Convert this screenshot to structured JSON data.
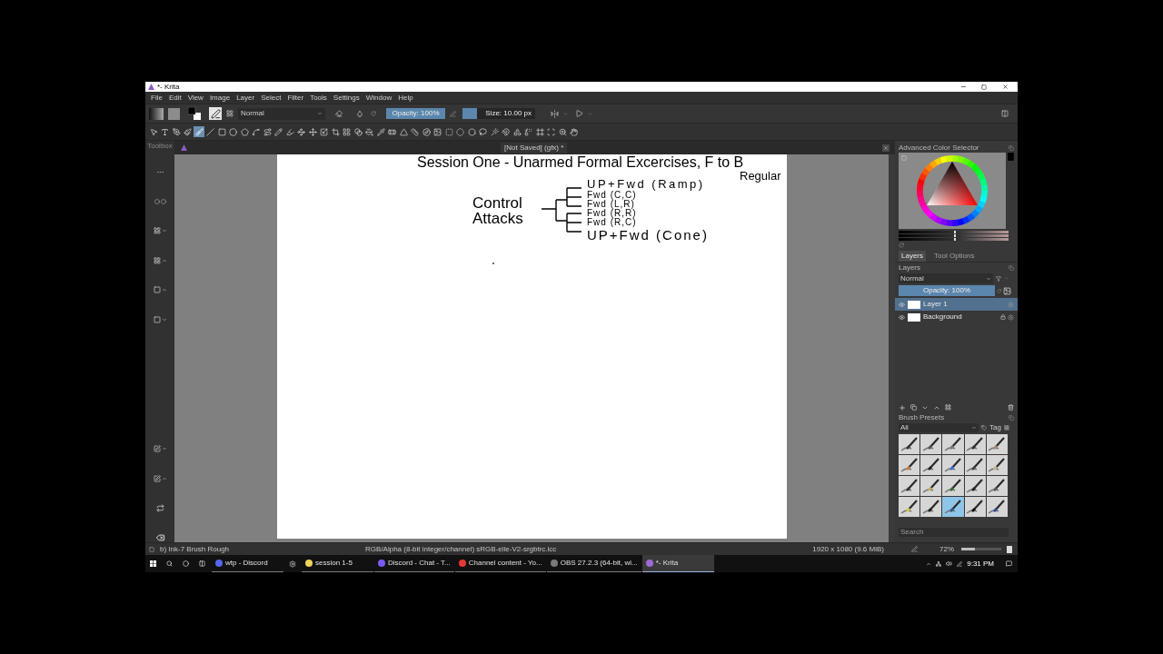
{
  "window": {
    "title": "*- Krita"
  },
  "menu": [
    "File",
    "Edit",
    "View",
    "Image",
    "Layer",
    "Select",
    "Filter",
    "Tools",
    "Settings",
    "Window",
    "Help"
  ],
  "tool_options": {
    "blend_mode": "Normal",
    "opacity": {
      "label": "Opacity: 100%",
      "level": 1
    },
    "size": {
      "label": "Size: 10.00 px",
      "level": 0.2
    }
  },
  "tools": [
    {
      "selected": false
    },
    {
      "selected": false
    },
    {
      "selected": false
    },
    {
      "selected": false
    },
    {
      "selected": true
    },
    {
      "selected": false
    },
    {
      "selected": false
    },
    {
      "selected": false
    },
    {
      "selected": false
    },
    {
      "selected": false
    },
    {
      "selected": false
    },
    {
      "selected": false
    },
    {
      "selected": false
    },
    {
      "selected": false
    },
    {
      "selected": false
    },
    {
      "selected": false
    },
    {
      "selected": false
    },
    {
      "selected": false
    },
    {
      "selected": false
    },
    {
      "selected": false
    },
    {
      "selected": false
    },
    {
      "selected": false
    },
    {
      "selected": false
    },
    {
      "selected": false
    },
    {
      "selected": false
    },
    {
      "selected": false
    },
    {
      "selected": false
    },
    {
      "selected": false
    },
    {
      "selected": false
    },
    {
      "selected": false
    },
    {
      "selected": false
    },
    {
      "selected": false
    },
    {
      "selected": false
    },
    {
      "selected": false
    },
    {
      "selected": false
    },
    {
      "selected": false
    },
    {
      "selected": false
    },
    {
      "selected": false
    }
  ],
  "toolbox": {
    "title": "Toolbox"
  },
  "document_tab": {
    "title": "[Not Saved] (gfx) *"
  },
  "canvas": {
    "heading": "Session One - Unarmed Formal Excercises, F to B",
    "note": "Regular",
    "group_label": [
      "Control",
      "Attacks"
    ],
    "branches": [
      "UP+Fwd (Ramp)",
      "Fwd (C,C)",
      "Fwd (L,R)",
      "Fwd (R,R)",
      "Fwd (R,C)",
      "UP+Fwd (Cone)"
    ]
  },
  "color_selector": {
    "title": "Advanced Color Selector",
    "sliders": [
      {
        "level": 0.5
      },
      {
        "level": 0.5
      },
      {
        "level": 0.5
      }
    ]
  },
  "dock_tabs": [
    {
      "label": "Layers",
      "selected": true
    },
    {
      "label": "Tool Options",
      "selected": false
    }
  ],
  "layers_panel": {
    "title": "Layers",
    "blend_mode": "Normal",
    "opacity": {
      "label": "Opacity: 100%",
      "level": 1
    },
    "layers": [
      {
        "name": "Layer 1",
        "selected": true,
        "visible": true,
        "locked": false
      },
      {
        "name": "Background",
        "selected": false,
        "visible": true,
        "locked": true
      }
    ]
  },
  "brush_presets": {
    "title": "Brush Presets",
    "filter": "All",
    "tag_label": "Tag",
    "presets": [
      {
        "selected": false
      },
      {
        "selected": false
      },
      {
        "selected": false
      },
      {
        "selected": false
      },
      {
        "selected": false
      },
      {
        "selected": false
      },
      {
        "selected": false
      },
      {
        "selected": false
      },
      {
        "selected": false
      },
      {
        "selected": false
      },
      {
        "selected": false
      },
      {
        "selected": false
      },
      {
        "selected": false
      },
      {
        "selected": false
      },
      {
        "selected": false
      },
      {
        "selected": false
      },
      {
        "selected": false
      },
      {
        "selected": true
      },
      {
        "selected": false
      },
      {
        "selected": false
      }
    ],
    "search": {
      "placeholder": "Search"
    }
  },
  "status_bar": {
    "brush": "b) Ink-7 Brush Rough",
    "color_space": "RGB/Alpha (8-bit integer/channel)  sRGB-elle-V2-srgbtrc.icc",
    "image_size": "1920 x 1080 (9.6 MiB)",
    "zoom": "72%",
    "zoom_slider": {
      "level": 0.35
    }
  },
  "taskbar": {
    "items": [
      {
        "kind": "window",
        "label": "wtp - Discord",
        "active": false
      },
      {
        "kind": "pinned"
      },
      {
        "kind": "window",
        "label": "session 1-5",
        "active": false
      },
      {
        "kind": "window",
        "label": "Discord - Chat - T...",
        "active": false
      },
      {
        "kind": "window",
        "label": "Channel content - Yo...",
        "active": false
      },
      {
        "kind": "window",
        "label": "OBS 27.2.3 (64-bit, wi...",
        "active": false
      },
      {
        "kind": "window",
        "label": "*- Krita",
        "active": true
      }
    ],
    "clock": "9:31 PM"
  }
}
